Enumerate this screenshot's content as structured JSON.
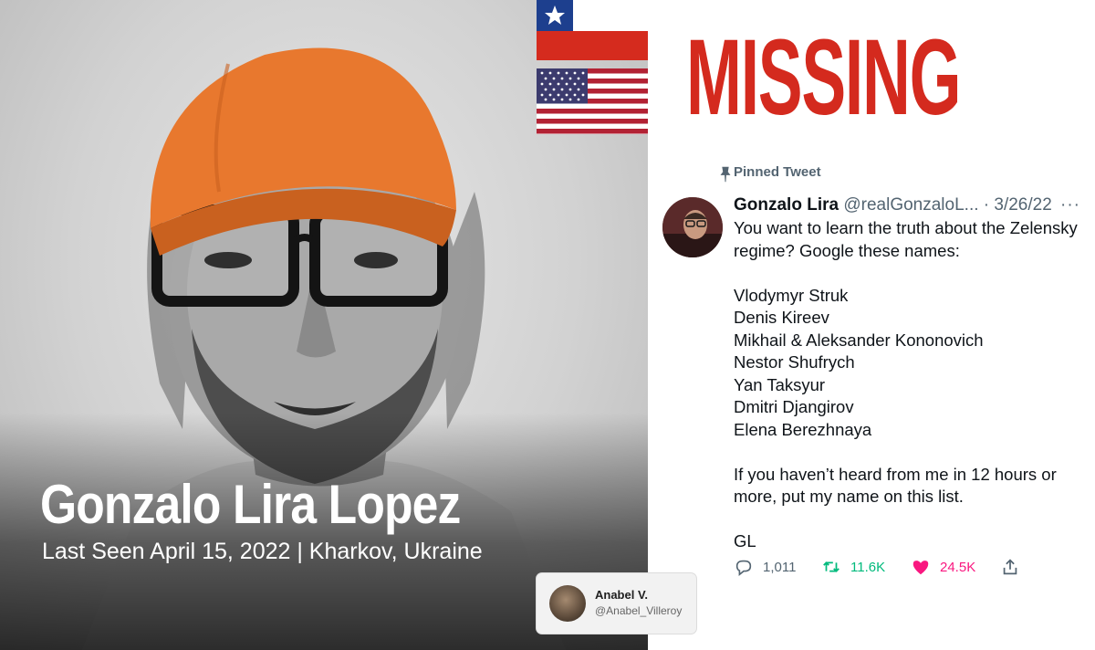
{
  "portrait": {
    "name": "Gonzalo Lira Lopez",
    "last_seen": "Last Seen April 15, 2022 | Kharkov, Ukraine"
  },
  "headline": "MISSING",
  "credit": {
    "name": "Anabel V.",
    "handle": "@Anabel_Villeroy"
  },
  "flags": [
    "chile-flag",
    "usa-flag"
  ],
  "tweet": {
    "pinned_label": "Pinned Tweet",
    "author_name": "Gonzalo Lira",
    "author_handle": "@realGonzaloL...",
    "separator": " · ",
    "date": "3/26/22",
    "more": "···",
    "lines": [
      "You want to learn the truth about the Zelensky regime? Google these names:",
      "",
      "Vlodymyr Struk",
      "Denis Kireev",
      "Mikhail & Aleksander Kononovich",
      "Nestor Shufrych",
      "Yan Taksyur",
      "Dmitri Djangirov",
      "Elena Berezhnaya",
      "",
      "If you haven’t heard from me in 12 hours or more, put my name on this list.",
      "",
      "GL"
    ],
    "actions": {
      "replies": "1,011",
      "retweets": "11.6K",
      "likes": "24.5K"
    }
  },
  "colors": {
    "missing_red": "#d42a1e",
    "retweet_green": "#00ba7c",
    "like_pink": "#f91880",
    "muted_gray": "#536471",
    "cap_orange": "#e8782e"
  }
}
